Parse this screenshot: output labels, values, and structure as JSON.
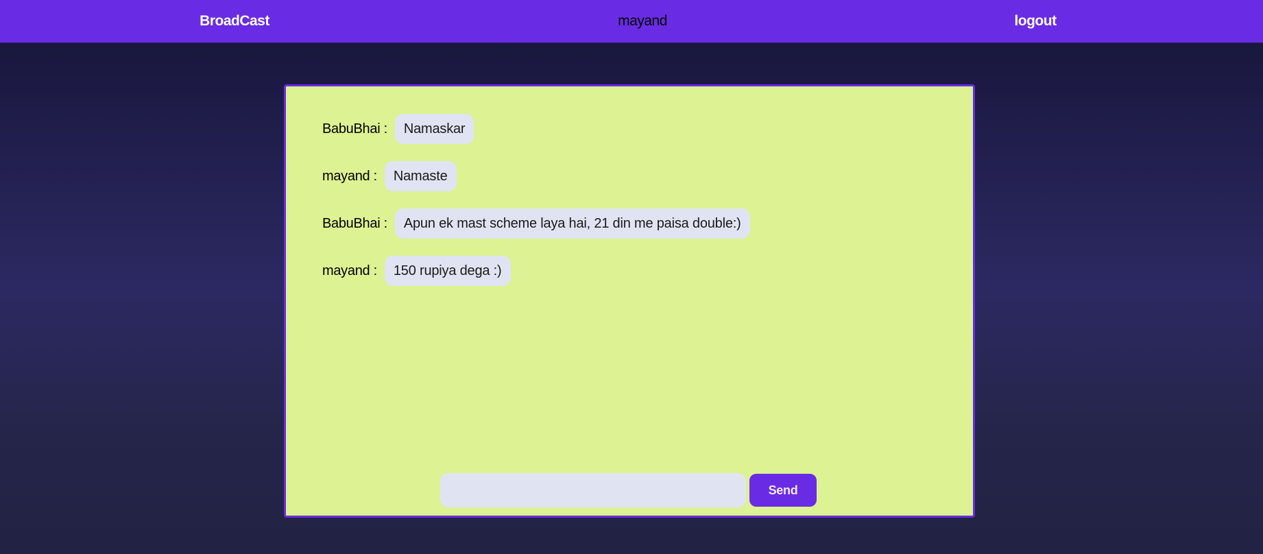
{
  "navbar": {
    "brand": "BroadCast",
    "username": "mayand",
    "logout_label": "logout"
  },
  "messages": [
    {
      "sender": "BabuBhai :",
      "text": "Namaskar"
    },
    {
      "sender": "mayand :",
      "text": "Namaste"
    },
    {
      "sender": "BabuBhai :",
      "text": "Apun ek mast scheme laya hai, 21 din me paisa double:)"
    },
    {
      "sender": "mayand :",
      "text": "150 rupiya dega :)"
    }
  ],
  "composer": {
    "input_value": "",
    "placeholder": "",
    "send_label": "Send"
  },
  "colors": {
    "accent": "#6a2be4",
    "panel": "#dcf293",
    "bubble": "#e0e4f2"
  }
}
